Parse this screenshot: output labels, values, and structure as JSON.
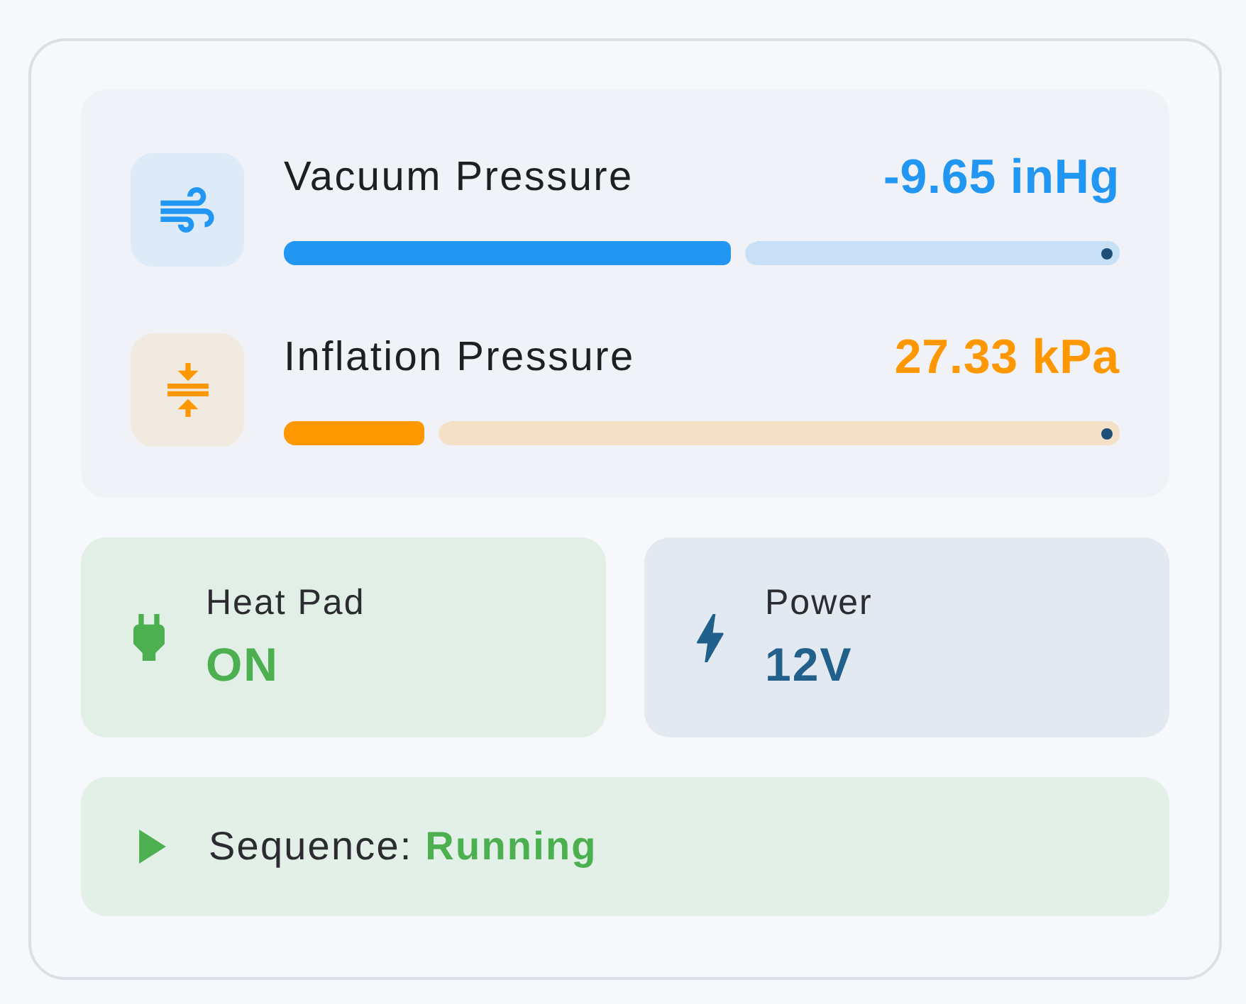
{
  "pressures": [
    {
      "kind": "vacuum",
      "label": "Vacuum Pressure",
      "reading": "-9.65 inHg",
      "level": 0.54,
      "color": "#2196f3"
    },
    {
      "kind": "inflation",
      "label": "Inflation Pressure",
      "reading": "27.33 kPa",
      "level": 0.17,
      "color": "#ff9800"
    }
  ],
  "status_tiles": [
    {
      "kind": "heat",
      "label": "Heat Pad",
      "value": "ON",
      "color": "#4caf50"
    },
    {
      "kind": "power",
      "label": "Power",
      "value": "12V",
      "color": "#22608c"
    }
  ],
  "sequence": {
    "text": "Sequence: **Running**"
  }
}
